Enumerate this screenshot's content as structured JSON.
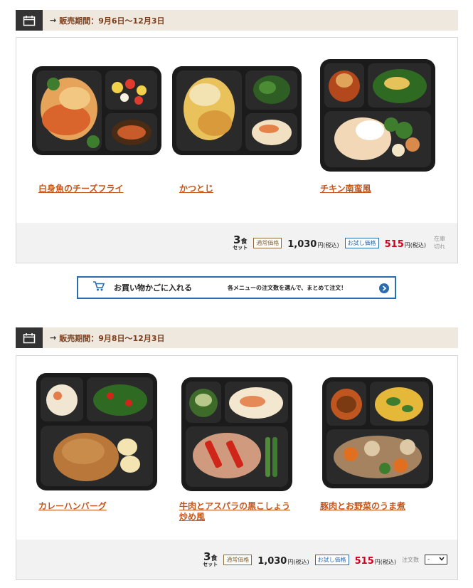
{
  "sections": [
    {
      "period": "販売期間：9月6日～12月3日",
      "products": [
        {
          "name": "白身魚のチーズフライ"
        },
        {
          "name": "かつとじ"
        },
        {
          "name": "チキン南蛮風"
        }
      ],
      "pricing": {
        "set_count": "3",
        "set_unit": "食",
        "set_label": "セット",
        "regular_tag": "通常価格",
        "regular_price": "1,030",
        "trial_tag": "お試し価格",
        "trial_price": "515",
        "yen_tax": "円(税込)",
        "stock_line1": "在庫",
        "stock_line2": "切れ"
      }
    },
    {
      "period": "販売期間：9月8日～12月3日",
      "products": [
        {
          "name": "カレーハンバーグ"
        },
        {
          "name_line1": "牛肉とアスパラの黒こしょう",
          "name_line2": "炒め風"
        },
        {
          "name": "豚肉とお野菜のうま煮"
        }
      ],
      "pricing": {
        "set_count": "3",
        "set_unit": "食",
        "set_label": "セット",
        "regular_tag": "通常価格",
        "regular_price": "1,030",
        "trial_tag": "お試し価格",
        "trial_price": "515",
        "yen_tax": "円(税込)",
        "qty_label": "注文数",
        "qty_value": "-"
      }
    }
  ],
  "cart": {
    "label": "お買い物かごに入れる",
    "description": "各メニューの注文数を選んで、まとめて注文！"
  },
  "colors": {
    "accent_orange": "#c5561b",
    "trial_red": "#d0021b",
    "trial_blue": "#2b6cb0",
    "header_bg": "#efe8de"
  }
}
